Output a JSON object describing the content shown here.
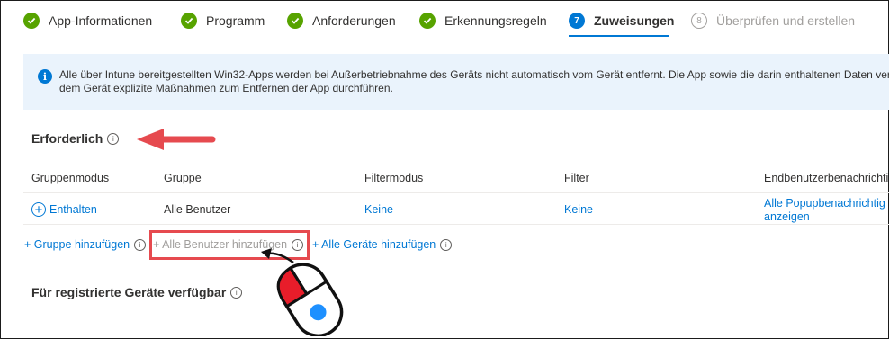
{
  "steps": [
    {
      "label": "App-Informationen",
      "state": "done"
    },
    {
      "label": "Programm",
      "state": "done"
    },
    {
      "label": "Anforderungen",
      "state": "done"
    },
    {
      "label": "Erkennungsregeln",
      "state": "done"
    },
    {
      "number": "7",
      "label": "Zuweisungen",
      "state": "current"
    },
    {
      "number": "8",
      "label": "Überprüfen und erstellen",
      "state": "future"
    }
  ],
  "banner": {
    "line1": "Alle über Intune bereitgestellten Win32-Apps werden bei Außerbetriebnahme des Geräts nicht automatisch vom Gerät entfernt. Die App sowie die darin enthaltenen Daten ver",
    "line2": "dem Gerät explizite Maßnahmen zum Entfernen der App durchführen.",
    "icon": "info-icon"
  },
  "required": {
    "title": "Erforderlich",
    "columns": [
      "Gruppenmodus",
      "Gruppe",
      "Filtermodus",
      "Filter",
      "Endbenutzerbenachrichti"
    ],
    "rows": [
      {
        "mode": "Enthalten",
        "group": "Alle Benutzer",
        "filter_mode": "Keine",
        "filter": "Keine",
        "notify_line1": "Alle Popupbenachrichtig",
        "notify_line2": "anzeigen"
      }
    ],
    "add_group": "+ Gruppe hinzufügen",
    "add_all_users": "+ Alle Benutzer hinzufügen",
    "add_all_devices": "+ Alle Geräte hinzufügen"
  },
  "available": {
    "title": "Für registrierte Geräte verfügbar"
  },
  "colors": {
    "accent": "#0078d4",
    "success": "#57a300",
    "highlight": "#e64a4f",
    "banner_bg": "#eaf3fc"
  }
}
